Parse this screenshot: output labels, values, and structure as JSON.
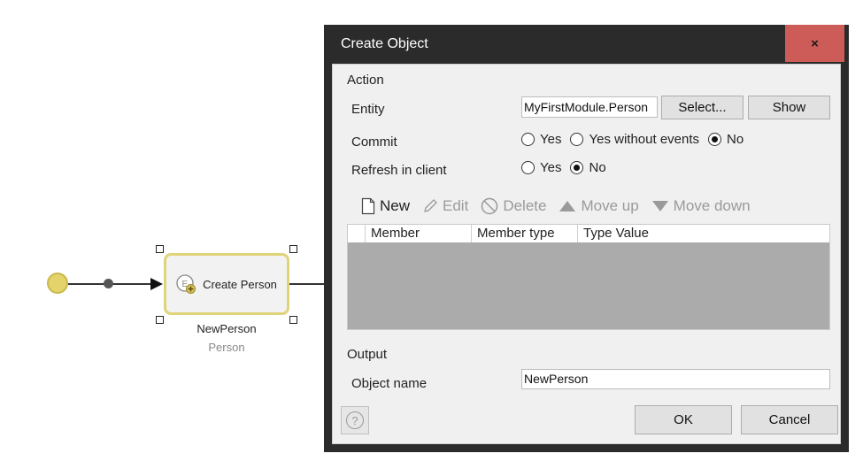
{
  "microflow": {
    "activity_label": "Create Person",
    "activity_name": "NewPerson",
    "activity_type": "Person"
  },
  "dialog": {
    "title": "Create Object",
    "close_label": "×",
    "action_section": "Action",
    "entity_label": "Entity",
    "entity_value": "MyFirstModule.Person",
    "select_label": "Select...",
    "show_label": "Show",
    "commit_label": "Commit",
    "commit_options": [
      "Yes",
      "Yes without events",
      "No"
    ],
    "commit_selected": "No",
    "refresh_label": "Refresh in client",
    "refresh_options": [
      "Yes",
      "No"
    ],
    "refresh_selected": "No",
    "toolbar": {
      "new": "New",
      "edit": "Edit",
      "delete": "Delete",
      "move_up": "Move up",
      "move_down": "Move down"
    },
    "grid_columns": [
      "Member",
      "Member type",
      "Type Value"
    ],
    "output_section": "Output",
    "object_name_label": "Object name",
    "object_name_value": "NewPerson",
    "ok_label": "OK",
    "cancel_label": "Cancel",
    "help_label": "?"
  },
  "colors": {
    "close_button": "#cd5c58",
    "activity_border": "#e0d47a",
    "start_event": "#e4d36a",
    "grid_empty": "#ababab"
  }
}
